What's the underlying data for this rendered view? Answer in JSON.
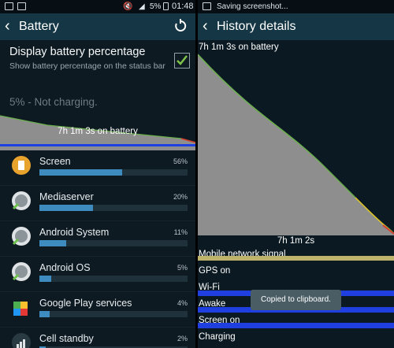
{
  "left": {
    "status_bar": {
      "battery_percent": "5%",
      "time": "01:48"
    },
    "app_bar": {
      "title": "Battery",
      "back_icon": "chevron-left-icon",
      "refresh_icon": "refresh-icon"
    },
    "display_percentage": {
      "title": "Display battery percentage",
      "subtitle": "Show battery percentage on the status bar",
      "checked": true
    },
    "battery_status": "5% - Not charging.",
    "mini_graph_label": "7h 1m 3s on battery",
    "apps": [
      {
        "name": "Screen",
        "percent": "56%",
        "usage": 0.56,
        "icon": "screen-brightness-icon"
      },
      {
        "name": "Mediaserver",
        "percent": "20%",
        "usage": 0.2,
        "icon": "android-app-icon"
      },
      {
        "name": "Android System",
        "percent": "11%",
        "usage": 0.11,
        "icon": "android-app-icon"
      },
      {
        "name": "Android OS",
        "percent": "5%",
        "usage": 0.05,
        "icon": "android-app-icon"
      },
      {
        "name": "Google Play services",
        "percent": "4%",
        "usage": 0.04,
        "icon": "puzzle-piece-icon"
      },
      {
        "name": "Cell standby",
        "percent": "2%",
        "usage": 0.02,
        "icon": "signal-icon"
      }
    ]
  },
  "right": {
    "status_bar": {
      "text": "Saving screenshot..."
    },
    "app_bar": {
      "title": "History details",
      "back_icon": "chevron-left-icon"
    },
    "graph_label_top": "7h 1m 3s on battery",
    "graph_label_bottom": "7h 1m 2s",
    "tracks": [
      {
        "label": "Mobile network signal",
        "color": "#bdb36a"
      },
      {
        "label": "GPS on",
        "color": ""
      },
      {
        "label": "Wi-Fi",
        "color": "#1f3fe0"
      },
      {
        "label": "Awake",
        "color": "#1f3fe0"
      },
      {
        "label": "Screen on",
        "color": "#1f3fe0"
      },
      {
        "label": "Charging",
        "color": ""
      }
    ],
    "toast": "Copied to clipboard."
  },
  "colors": {
    "app_bar": "#143645",
    "background": "#0e1a22",
    "usage_bar": "#3d8bbf",
    "checkbox_check": "#7ec24a",
    "graph_fill": "#8e8e8e"
  }
}
